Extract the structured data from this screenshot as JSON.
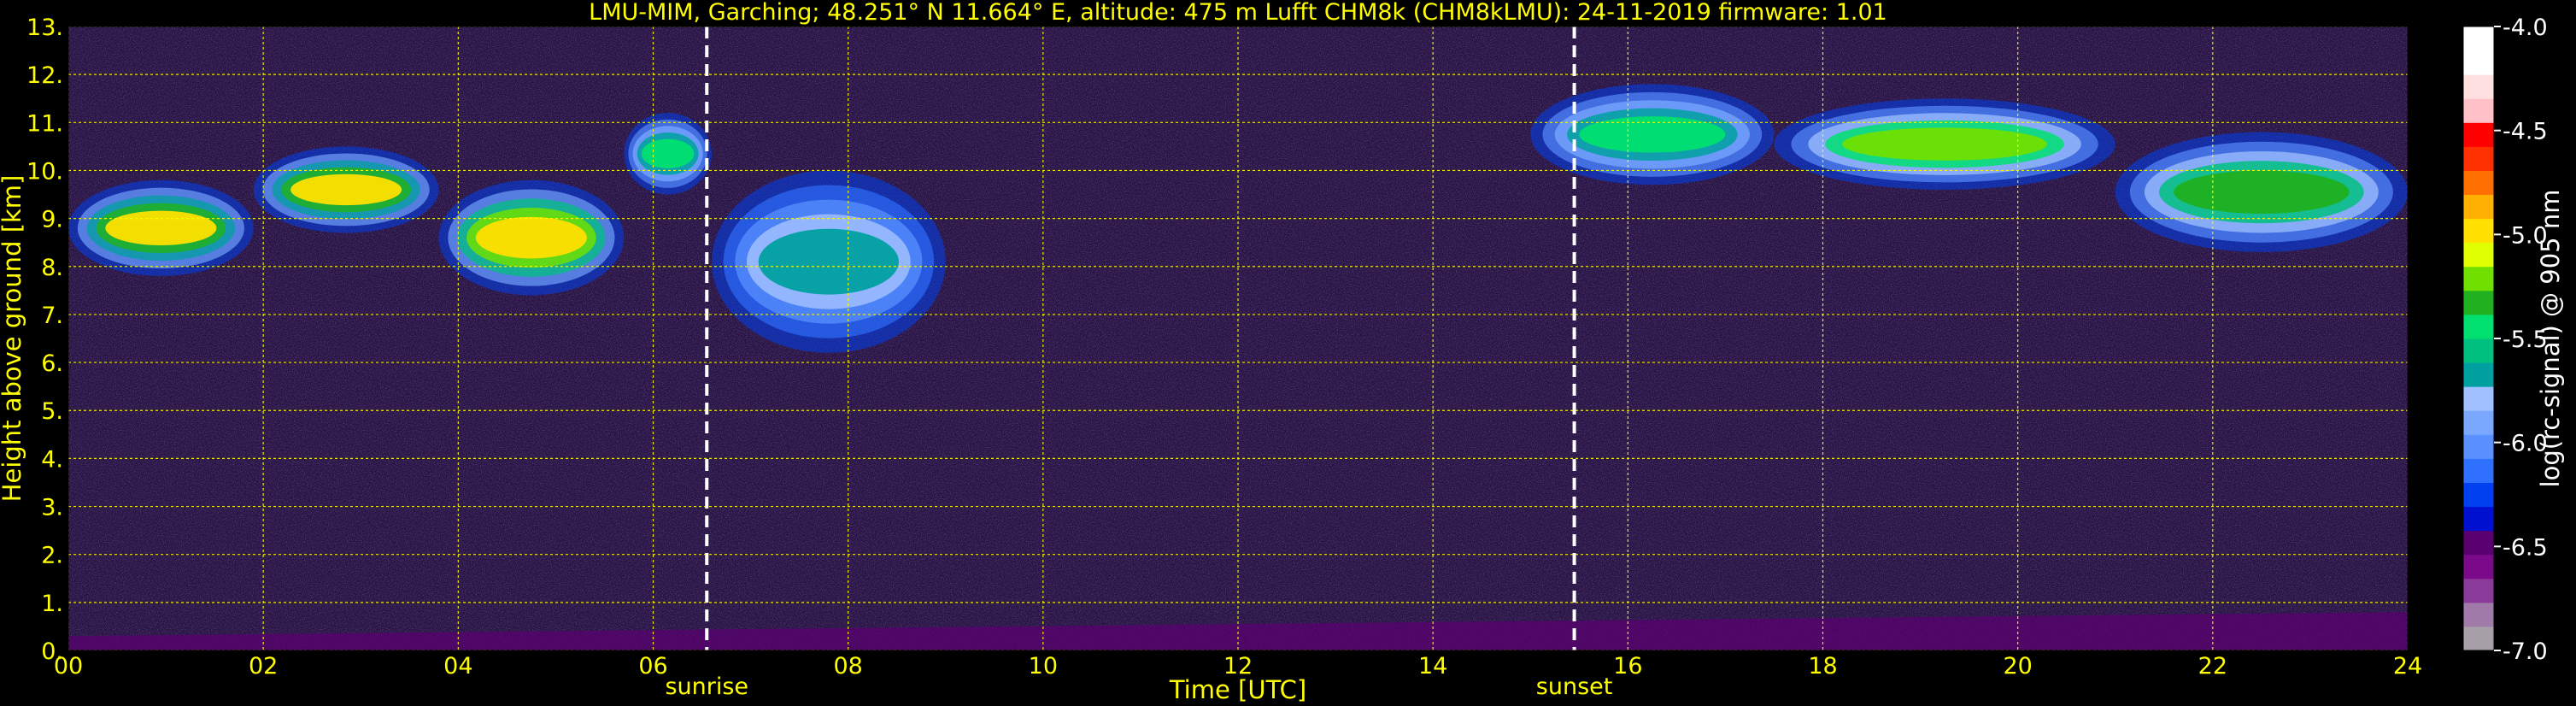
{
  "chart_data": {
    "type": "heatmap",
    "title": "LMU-MIM, Garching; 48.251° N 11.664° E, altitude: 475 m    Lufft CHM8k (CHM8kLMU): 24-11-2019    firmware: 1.01",
    "xlabel": "Time [UTC]",
    "ylabel": "Height above ground [km]",
    "xlim": [
      0,
      24
    ],
    "ylim": [
      0,
      13
    ],
    "x_ticks": [
      "00",
      "02",
      "04",
      "06",
      "08",
      "10",
      "12",
      "14",
      "16",
      "18",
      "20",
      "22",
      "24"
    ],
    "x_tick_values": [
      0,
      2,
      4,
      6,
      8,
      10,
      12,
      14,
      16,
      18,
      20,
      22,
      24
    ],
    "y_ticks": [
      "0.",
      "1.",
      "2.",
      "3.",
      "4.",
      "5.",
      "6.",
      "7.",
      "8.",
      "9.",
      "10.",
      "11.",
      "12.",
      "13."
    ],
    "y_tick_values": [
      0,
      1,
      2,
      3,
      4,
      5,
      6,
      7,
      8,
      9,
      10,
      11,
      12,
      13
    ],
    "grid": true,
    "grid_color": "#ffff00",
    "background_color": "#2a1445",
    "noise_color": "#4a4f9a",
    "events": [
      {
        "label": "sunrise",
        "time": 6.55
      },
      {
        "label": "sunset",
        "time": 15.45
      }
    ],
    "colorbar": {
      "label": "log(rc-signal) @ 905 nm",
      "min": -7.0,
      "max": -4.0,
      "ticks": [
        "-4.0",
        "-4.5",
        "-5.0",
        "-5.5",
        "-6.0",
        "-6.5",
        "-7.0"
      ],
      "tick_values": [
        -4.0,
        -4.5,
        -5.0,
        -5.5,
        -6.0,
        -6.5,
        -7.0
      ],
      "colors": [
        "#a8a0a8",
        "#a07aa8",
        "#8a3a98",
        "#7a0a8a",
        "#5a0070",
        "#0010d0",
        "#0040f0",
        "#3070ff",
        "#5a90ff",
        "#7aa8ff",
        "#a0c0ff",
        "#00a0a0",
        "#00c080",
        "#00e070",
        "#20b020",
        "#70e000",
        "#e0ff00",
        "#ffe000",
        "#ffb000",
        "#ff7000",
        "#ff3000",
        "#ff0000",
        "#ffc0c8",
        "#ffe0e0",
        "#ffffff",
        "#ffffff"
      ]
    },
    "cloud_layers": [
      {
        "t0": 0.0,
        "t1": 1.9,
        "base": 7.8,
        "top": 9.8,
        "intensity": -5.0
      },
      {
        "t0": 1.9,
        "t1": 3.8,
        "base": 8.7,
        "top": 10.5,
        "intensity": -5.0
      },
      {
        "t0": 3.8,
        "t1": 5.7,
        "base": 7.4,
        "top": 9.8,
        "intensity": -4.9
      },
      {
        "t0": 5.7,
        "t1": 6.6,
        "base": 9.5,
        "top": 11.2,
        "intensity": -5.5
      },
      {
        "t0": 6.6,
        "t1": 9.0,
        "base": 6.2,
        "top": 10.0,
        "intensity": -5.7
      },
      {
        "t0": 15.0,
        "t1": 17.5,
        "base": 9.7,
        "top": 11.8,
        "intensity": -5.5
      },
      {
        "t0": 17.5,
        "t1": 21.0,
        "base": 9.6,
        "top": 11.5,
        "intensity": -5.2
      },
      {
        "t0": 21.0,
        "t1": 24.0,
        "base": 8.3,
        "top": 10.8,
        "intensity": -5.3
      }
    ],
    "boundary_layer": {
      "height_start": 0.3,
      "height_end": 0.8,
      "intensity": -6.5
    }
  }
}
